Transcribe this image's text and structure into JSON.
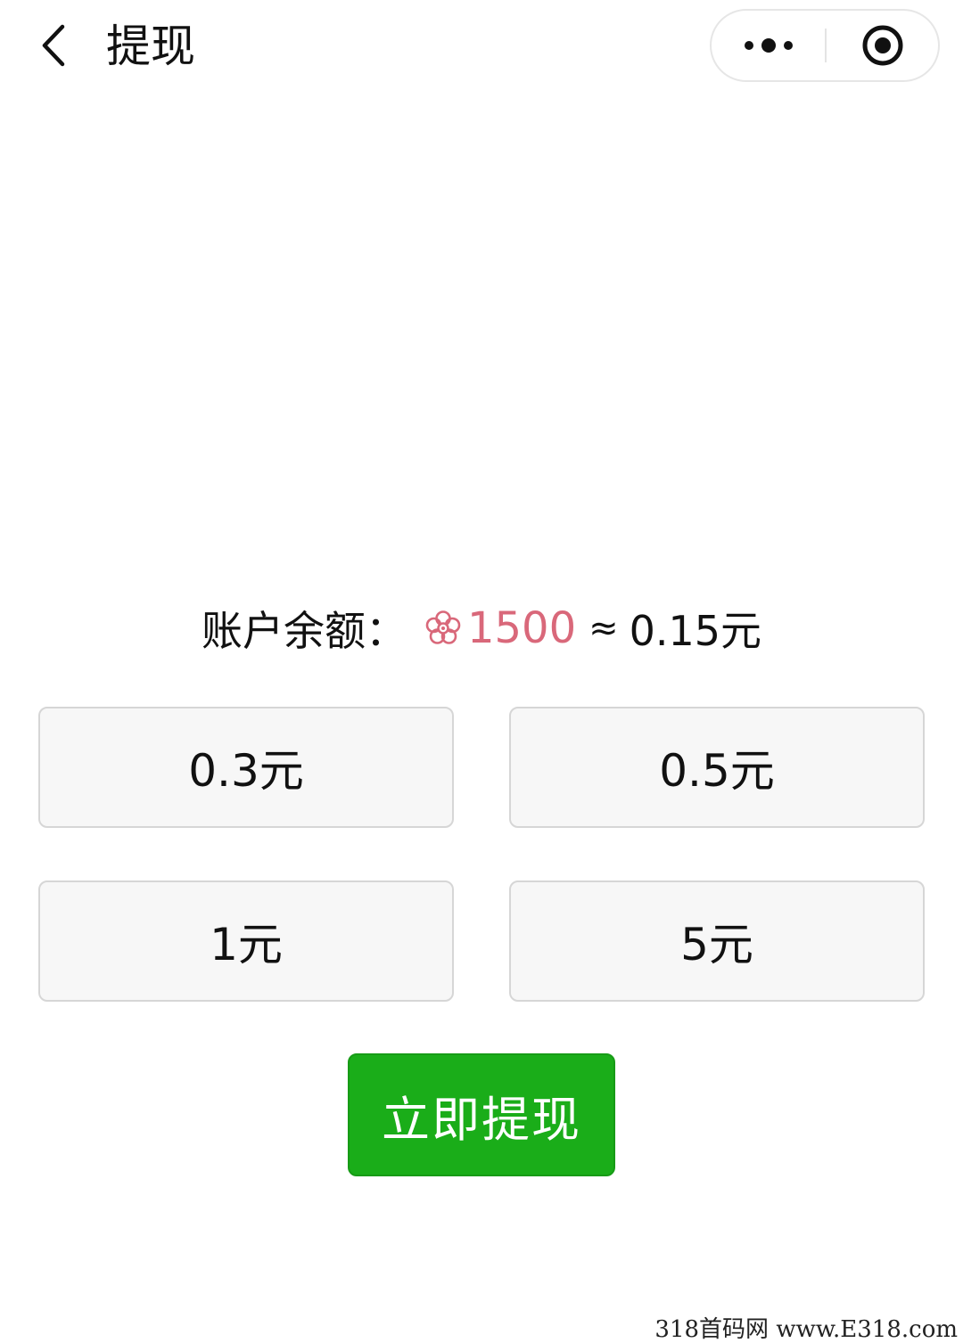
{
  "nav": {
    "title": "提现"
  },
  "balance": {
    "label": "账户余额：",
    "coin_amount": "1500",
    "approx_sign": "≈",
    "cash_amount": "0.15元",
    "coin_color": "#d9687a"
  },
  "options": [
    {
      "label": "0.3元"
    },
    {
      "label": "0.5元"
    },
    {
      "label": "1元"
    },
    {
      "label": "5元"
    }
  ],
  "withdraw_button": {
    "label": "立即提现",
    "color": "#1aad19"
  },
  "watermark": "318首码网  www.E318.com",
  "icons": {
    "back": "chevron-left-icon",
    "more": "more-dots-icon",
    "close": "target-close-icon",
    "coin": "flower-coin-icon"
  }
}
